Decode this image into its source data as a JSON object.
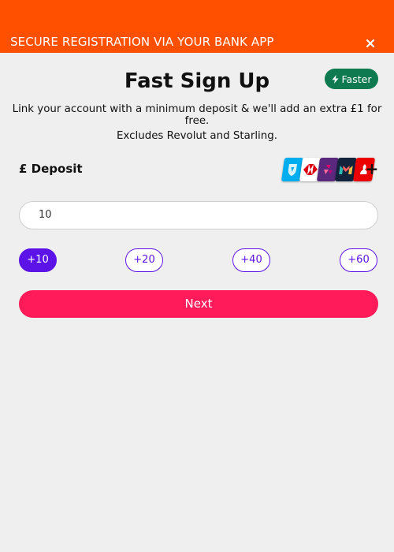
{
  "header": {
    "title": "SECURE REGISTRATION VIA YOUR BANK APP",
    "close_icon": "close-icon",
    "background": "#ff5000"
  },
  "main": {
    "title": "Fast Sign Up",
    "badge": {
      "label": "Faster",
      "icon": "lightning-icon",
      "color": "#0f7a50"
    },
    "subtitle": "Link your account with a minimum deposit & we'll add an extra £1 for free.",
    "note": "Excludes Revolut and Starling."
  },
  "deposit": {
    "label": "£ Deposit",
    "banks": [
      {
        "name": "barclays-logo-icon",
        "color": "#00aeef"
      },
      {
        "name": "hsbc-logo-icon",
        "color": "#db0011"
      },
      {
        "name": "natwest-logo-icon",
        "color": "#5a287d"
      },
      {
        "name": "monzo-logo-icon",
        "color": "#14233c"
      },
      {
        "name": "santander-logo-icon",
        "color": "#ec0000"
      }
    ],
    "more_icon": "plus-icon",
    "amount_value": "10",
    "quick_amounts": [
      "+10",
      "+20",
      "+40",
      "+60"
    ],
    "selected_quick_amount": "+10",
    "accent_color": "#5b13e8"
  },
  "actions": {
    "next_label": "Next",
    "next_color": "#ff1a5a"
  }
}
